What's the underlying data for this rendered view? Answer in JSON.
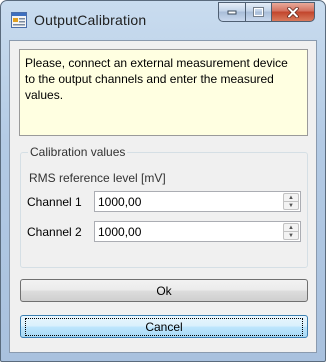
{
  "window": {
    "title": "OutputCalibration",
    "icon": "app-window-icon"
  },
  "info": {
    "message": "Please, connect an external measurement device to the output channels and enter the measured values."
  },
  "calibration": {
    "group_title": "Calibration values",
    "rms_label": "RMS reference level [mV]",
    "channels": [
      {
        "label": "Channel 1",
        "value": "1000,00"
      },
      {
        "label": "Channel 2",
        "value": "1000,00"
      }
    ]
  },
  "buttons": {
    "ok": "Ok",
    "cancel": "Cancel"
  }
}
